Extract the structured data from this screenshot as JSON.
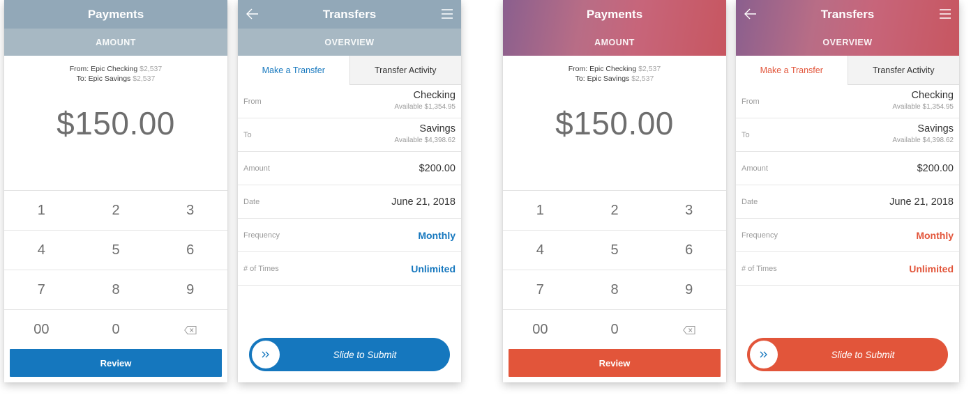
{
  "payments": {
    "title": "Payments",
    "subtitle": "AMOUNT",
    "from_label": "From: Epic Checking",
    "from_amount": "$2,537",
    "to_label": "To: Epic Savings",
    "to_amount": "$2,537",
    "amount": "$150.00",
    "keys": [
      [
        "1",
        "2",
        "3"
      ],
      [
        "4",
        "5",
        "6"
      ],
      [
        "7",
        "8",
        "9"
      ],
      [
        "00",
        "0",
        "backspace-icon"
      ]
    ],
    "review_label": "Review"
  },
  "transfers": {
    "title": "Transfers",
    "subtitle": "OVERVIEW",
    "tab_make": "Make a Transfer",
    "tab_activity": "Transfer Activity",
    "from_label": "From",
    "from_value": "Checking",
    "from_available": "Available $1,354.95",
    "to_label": "To",
    "to_value": "Savings",
    "to_available": "Available $4,398.62",
    "amount_label": "Amount",
    "amount_value": "$200.00",
    "date_label": "Date",
    "date_value": "June 21, 2018",
    "frequency_label": "Frequency",
    "frequency_value": "Monthly",
    "times_label": "# of Times",
    "times_value": "Unlimited",
    "slide_label": "Slide to Submit"
  },
  "themes": {
    "blue": {
      "accent": "#1577be",
      "header": "#92a8b8",
      "subheader": "#a7b8c3"
    },
    "red": {
      "accent": "#e2553a",
      "header_gradient": [
        "#8a5f8e",
        "#c75660"
      ]
    }
  }
}
